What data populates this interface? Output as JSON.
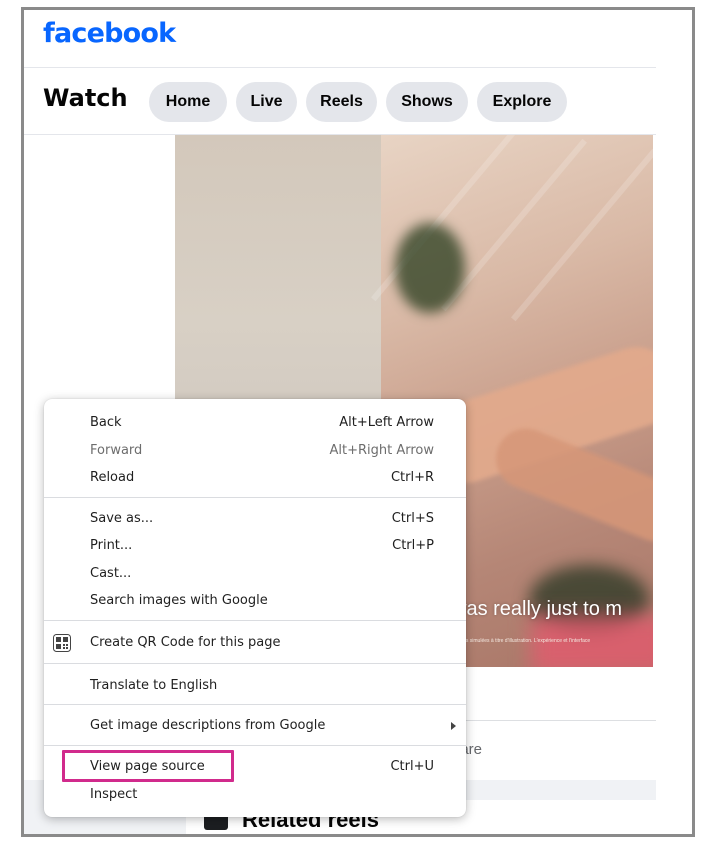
{
  "header": {
    "logo": "facebook"
  },
  "watch": {
    "title": "Watch",
    "tabs": [
      {
        "label": "Home"
      },
      {
        "label": "Live"
      },
      {
        "label": "Reels"
      },
      {
        "label": "Shows"
      },
      {
        "label": "Explore"
      }
    ]
  },
  "video": {
    "caption": "was really just to m",
    "disclaimer": "Images simulées à titre d'illustration. L'expérience et l'interface"
  },
  "actions": {
    "share_partial": "hare"
  },
  "related": {
    "title": "Related reels"
  },
  "context_menu": {
    "items": [
      {
        "label": "Back",
        "shortcut": "Alt+Left Arrow"
      },
      {
        "label": "Forward",
        "shortcut": "Alt+Right Arrow"
      },
      {
        "label": "Reload",
        "shortcut": "Ctrl+R"
      },
      {
        "label": "Save as...",
        "shortcut": "Ctrl+S"
      },
      {
        "label": "Print...",
        "shortcut": "Ctrl+P"
      },
      {
        "label": "Cast..."
      },
      {
        "label": "Search images with Google"
      },
      {
        "label": "Create QR Code for this page",
        "icon": "qr-code-icon"
      },
      {
        "label": "Translate to English"
      },
      {
        "label": "Get image descriptions from Google",
        "icon": "chevron-right-icon"
      },
      {
        "label": "View page source",
        "shortcut": "Ctrl+U"
      },
      {
        "label": "Inspect"
      }
    ]
  },
  "colors": {
    "brand": "#0866ff",
    "tab_bg": "#e4e6eb",
    "highlight": "#d12a8c"
  }
}
